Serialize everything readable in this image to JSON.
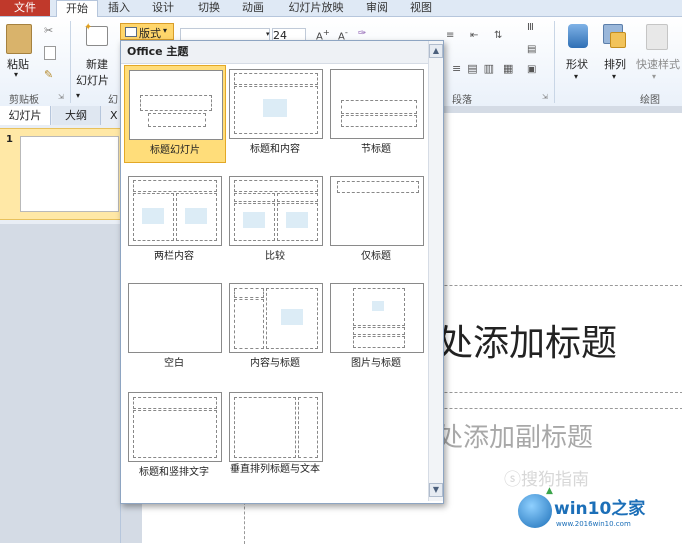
{
  "tabs": [
    "文件",
    "开始",
    "插入",
    "设计",
    "切换",
    "动画",
    "幻灯片放映",
    "审阅",
    "视图"
  ],
  "ribbon": {
    "paste": "粘贴",
    "clipboard": "剪贴板",
    "new_slide_1": "新建",
    "new_slide_2": "幻灯片",
    "layout_button": "版式",
    "slides_group_fragment": "幻",
    "font_size": "24",
    "paragraph": "段落",
    "shape": "形状",
    "arrange": "排列",
    "quick_styles": "快速样式",
    "drawing": "绘图"
  },
  "panel": {
    "tab_slides": "幻灯片",
    "tab_outline": "大纲",
    "close": "X",
    "slide_number": "1"
  },
  "slide": {
    "title_fragment": "处添加标题",
    "subtitle_fragment": "处添加副标题"
  },
  "gallery": {
    "header": "Office 主题",
    "layouts": [
      "标题幻灯片",
      "标题和内容",
      "节标题",
      "两栏内容",
      "比较",
      "仅标题",
      "空白",
      "内容与标题",
      "图片与标题",
      "标题和竖排文字",
      "垂直排列标题与文本"
    ]
  },
  "watermark": "搜狗指南",
  "logo": {
    "name": "win10之家",
    "url": "www.2016win10.com"
  },
  "colors": {
    "file_tab": "#c0392b",
    "highlight": "#ffdd7a",
    "logo_blue": "#1c6fb8"
  }
}
